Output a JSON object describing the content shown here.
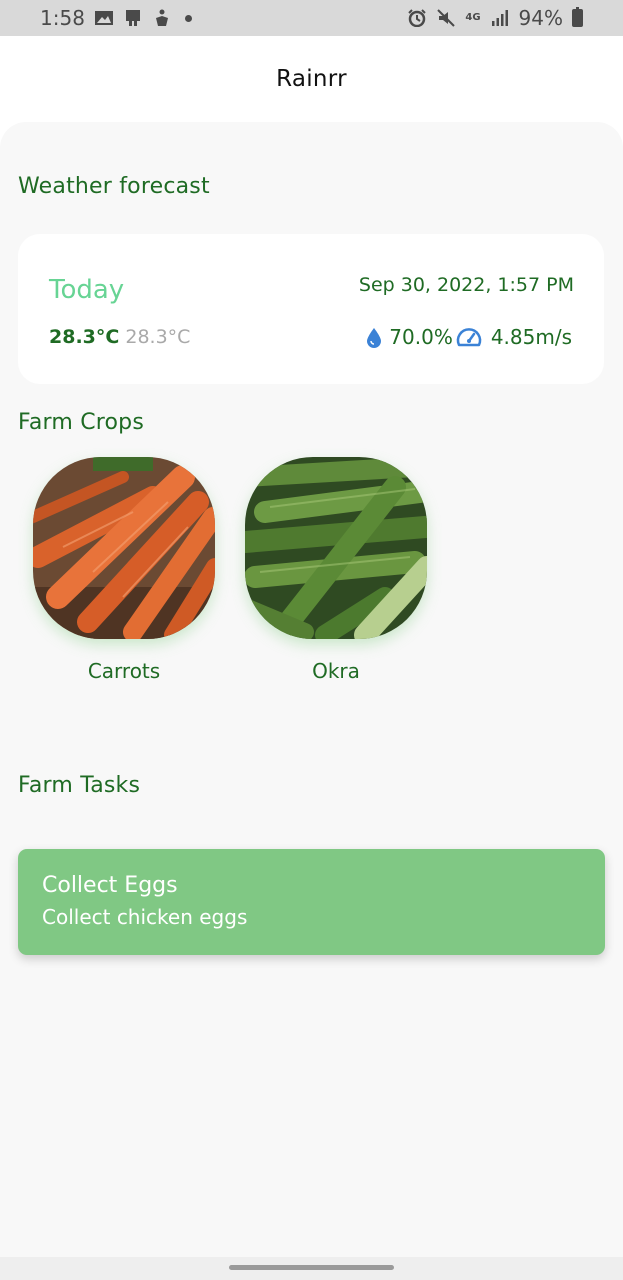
{
  "status_bar": {
    "time": "1:58",
    "network": "4G",
    "battery": "94%"
  },
  "app_bar": {
    "title": "Rainrr"
  },
  "weather": {
    "section_title": "Weather forecast",
    "day_label": "Today",
    "datetime": "Sep 30, 2022, 1:57 PM",
    "temp_main": "28.3°C",
    "temp_alt": "28.3°C",
    "humidity": "70.0%",
    "wind_speed": "4.85m/s",
    "humidity_icon": "water-drop-icon",
    "wind_icon": "speedometer-icon"
  },
  "crops": {
    "section_title": "Farm Crops",
    "items": [
      {
        "name": "Carrots",
        "image": "carrots-photo"
      },
      {
        "name": "Okra",
        "image": "okra-photo"
      }
    ]
  },
  "tasks": {
    "section_title": "Farm Tasks",
    "items": [
      {
        "title": "Collect Eggs",
        "description": "Collect chicken eggs"
      }
    ]
  },
  "colors": {
    "primary_green": "#1f6b24",
    "today_green": "#67d494",
    "task_card": "#80c884",
    "icon_blue": "#3b82d6"
  }
}
